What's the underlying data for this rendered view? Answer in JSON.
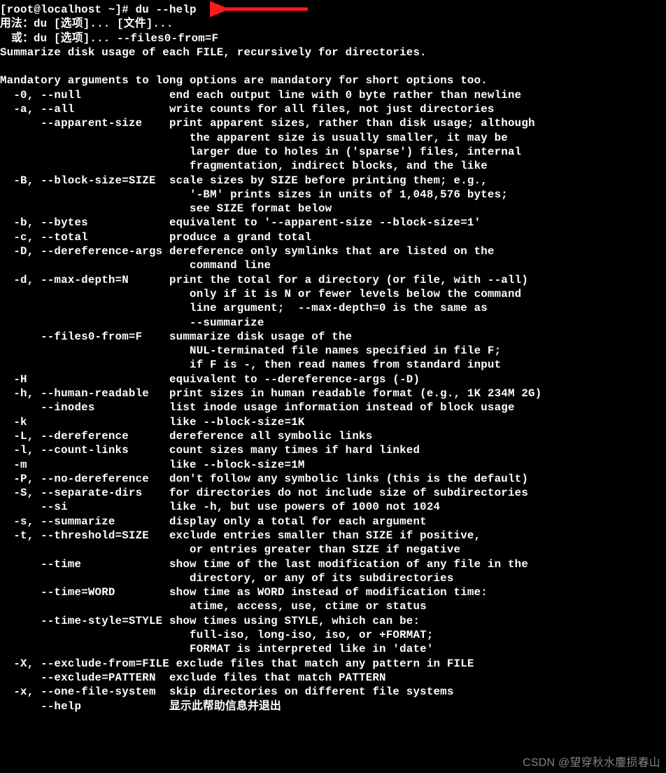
{
  "prompt": "[root@localhost ~]# ",
  "command": "du --help",
  "usage_lines": [
    "用法：du [选项]... [文件]...",
    "　或：du [选项]... --files0-from=F"
  ],
  "summary": "Summarize disk usage of each FILE, recursively for directories.",
  "mandatory_note": "Mandatory arguments to long options are mandatory for short options too.",
  "options": [
    {
      "flags": "-0, --null",
      "desc": "end each output line with 0 byte rather than newline"
    },
    {
      "flags": "-a, --all",
      "desc": "write counts for all files, not just directories",
      "cont": []
    },
    {
      "flags": "    --apparent-size",
      "desc": "print apparent sizes, rather than disk usage; although",
      "cont": [
        "the apparent size is usually smaller, it may be",
        "larger due to holes in ('sparse') files, internal",
        "fragmentation, indirect blocks, and the like"
      ]
    },
    {
      "flags": "-B, --block-size=SIZE",
      "desc": "scale sizes by SIZE before printing them; e.g.,",
      "cont": [
        "'-BM' prints sizes in units of 1,048,576 bytes;",
        "see SIZE format below"
      ]
    },
    {
      "flags": "-b, --bytes",
      "desc": "equivalent to '--apparent-size --block-size=1'"
    },
    {
      "flags": "-c, --total",
      "desc": "produce a grand total"
    },
    {
      "flags": "-D, --dereference-args",
      "desc": "dereference only symlinks that are listed on the",
      "cont": [
        "command line"
      ]
    },
    {
      "flags": "-d, --max-depth=N",
      "desc": "print the total for a directory (or file, with --all)",
      "cont": [
        "only if it is N or fewer levels below the command",
        "line argument;  --max-depth=0 is the same as",
        "--summarize"
      ]
    },
    {
      "flags": "    --files0-from=F",
      "desc": "summarize disk usage of the",
      "cont": [
        "NUL-terminated file names specified in file F;",
        "if F is -, then read names from standard input"
      ]
    },
    {
      "flags": "-H",
      "desc": "equivalent to --dereference-args (-D)"
    },
    {
      "flags": "-h, --human-readable",
      "desc": "print sizes in human readable format (e.g., 1K 234M 2G)"
    },
    {
      "flags": "    --inodes",
      "desc": "list inode usage information instead of block usage"
    },
    {
      "flags": "-k",
      "desc": "like --block-size=1K"
    },
    {
      "flags": "-L, --dereference",
      "desc": "dereference all symbolic links"
    },
    {
      "flags": "-l, --count-links",
      "desc": "count sizes many times if hard linked"
    },
    {
      "flags": "-m",
      "desc": "like --block-size=1M"
    },
    {
      "flags": "-P, --no-dereference",
      "desc": "don't follow any symbolic links (this is the default)"
    },
    {
      "flags": "-S, --separate-dirs",
      "desc": "for directories do not include size of subdirectories"
    },
    {
      "flags": "    --si",
      "desc": "like -h, but use powers of 1000 not 1024"
    },
    {
      "flags": "-s, --summarize",
      "desc": "display only a total for each argument"
    },
    {
      "flags": "-t, --threshold=SIZE",
      "desc": "exclude entries smaller than SIZE if positive,",
      "cont": [
        "or entries greater than SIZE if negative"
      ]
    },
    {
      "flags": "    --time",
      "desc": "show time of the last modification of any file in the",
      "cont": [
        "directory, or any of its subdirectories"
      ]
    },
    {
      "flags": "    --time=WORD",
      "desc": "show time as WORD instead of modification time:",
      "cont": [
        "atime, access, use, ctime or status"
      ]
    },
    {
      "flags": "    --time-style=STYLE",
      "desc": "show times using STYLE, which can be:",
      "cont": [
        "full-iso, long-iso, iso, or +FORMAT;",
        "FORMAT is interpreted like in 'date'"
      ]
    },
    {
      "flags": "-X, --exclude-from=FILE",
      "desc": "exclude files that match any pattern in FILE"
    },
    {
      "flags": "    --exclude=PATTERN",
      "desc": "exclude files that match PATTERN"
    },
    {
      "flags": "-x, --one-file-system",
      "desc": "skip directories on different file systems"
    },
    {
      "flags": "    --help",
      "desc": "显示此帮助信息并退出"
    }
  ],
  "flags_col_width": 22,
  "option_indent": "  ",
  "cont_indent": "                            ",
  "watermark": "CSDN @望穿秋水鏖损春山"
}
